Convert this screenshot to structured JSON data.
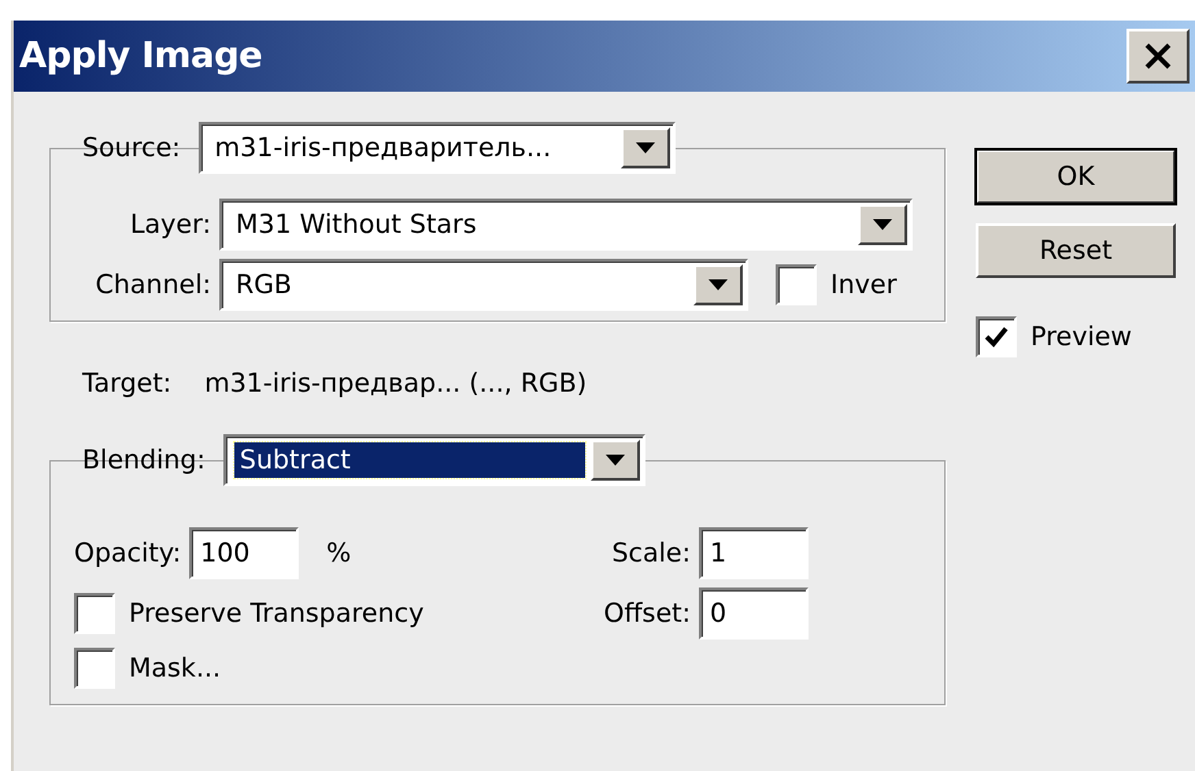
{
  "window": {
    "title": "Apply Image"
  },
  "source": {
    "label": "Source:",
    "value": "m31-iris-предваритель..."
  },
  "layer": {
    "label": "Layer:",
    "value": "M31 Without Stars"
  },
  "channel": {
    "label": "Channel:",
    "value": "RGB"
  },
  "invert": {
    "label": "Inver",
    "checked": false
  },
  "target": {
    "label": "Target:",
    "value": "m31-iris-предвар... (..., RGB)"
  },
  "blending": {
    "label": "Blending:",
    "value": "Subtract",
    "focused": true
  },
  "opacity": {
    "label": "Opacity:",
    "value": "100",
    "unit": "%"
  },
  "scale": {
    "label": "Scale:",
    "value": "1"
  },
  "offset": {
    "label": "Offset:",
    "value": "0"
  },
  "preserve_transparency": {
    "label": "Preserve Transparency",
    "checked": false
  },
  "mask": {
    "label": "Mask...",
    "checked": false
  },
  "buttons": [
    {
      "label": "OK",
      "default": true
    },
    {
      "label": "Reset",
      "default": false
    }
  ],
  "preview": {
    "label": "Preview",
    "checked": true
  }
}
